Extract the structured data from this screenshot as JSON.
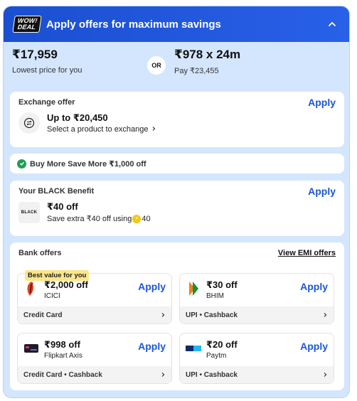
{
  "header": {
    "badge_line1": "WOW!",
    "badge_line2": "DEAL",
    "title": "Apply offers for maximum savings"
  },
  "price": {
    "lowest_price": "₹17,959",
    "lowest_label": "Lowest price for you",
    "or_label": "OR",
    "emi_price": "₹978 x 24m",
    "emi_label": "Pay ₹23,455"
  },
  "exchange": {
    "title": "Exchange offer",
    "apply_label": "Apply",
    "main": "Up to ₹20,450",
    "sub": "Select a product to exchange"
  },
  "bmsm": {
    "text": "Buy More Save More ₹1,000 off"
  },
  "black_benefit": {
    "title": "Your BLACK Benefit",
    "apply_label": "Apply",
    "logo_text": "BLACK",
    "main": "₹40 off",
    "sub_prefix": "Save extra ₹40 off using",
    "coin_value": "40"
  },
  "bank_offers": {
    "title": "Bank offers",
    "view_emi_label": "View EMI offers",
    "best_tag": "Best value for you",
    "offers": [
      {
        "amount": "₹2,000 off",
        "bank": "ICICI",
        "type": "Credit Card",
        "apply_label": "Apply"
      },
      {
        "amount": "₹30 off",
        "bank": "BHIM",
        "type": "UPI • Cashback",
        "apply_label": "Apply"
      },
      {
        "amount": "₹998 off",
        "bank": "Flipkart Axis",
        "type": "Credit Card • Cashback",
        "apply_label": "Apply"
      },
      {
        "amount": "₹20 off",
        "bank": "Paytm",
        "type": "UPI • Cashback",
        "apply_label": "Apply"
      }
    ]
  },
  "colors": {
    "header_blue": "#2860e8",
    "panel_bg": "#d4e6fd",
    "apply_blue": "#1a56db",
    "check_green": "#1f9d55",
    "best_tag_yellow": "#fde68a"
  },
  "icons": [
    "chevron-up-icon",
    "exchange-icon",
    "chevron-right-icon",
    "check-icon",
    "coin-icon",
    "icici-logo",
    "bhim-logo",
    "flipkart-axis-card-icon",
    "paytm-logo"
  ]
}
